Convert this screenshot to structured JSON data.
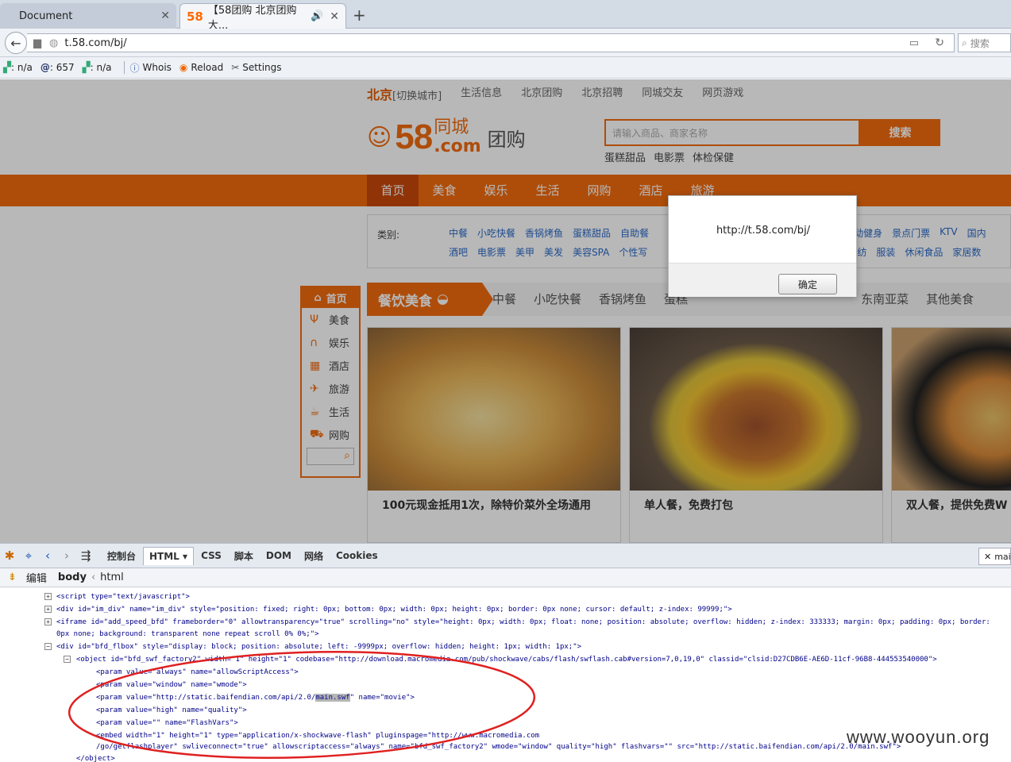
{
  "browser": {
    "tabs": [
      {
        "label": "Document"
      },
      {
        "label": "【58团购 北京团购大..."
      }
    ],
    "url": "t.58.com/bj/",
    "search_placeholder": "搜索",
    "addons": {
      "pr_value": ": n/a",
      "alexa_value": ": 657",
      "pr2_value": ": n/a",
      "whois": "Whois",
      "reload": "Reload",
      "settings": "Settings"
    }
  },
  "site": {
    "city": "北京",
    "switch_city": "[切换城市]",
    "top_links": [
      "生活信息",
      "北京团购",
      "北京招聘",
      "同城交友",
      "网页游戏"
    ],
    "logo_58": "58",
    "logo_tc": "同城",
    "logo_com": ".com",
    "logo_tg": "团购",
    "search_placeholder": "请输入商品、商家名称",
    "search_button": "搜索",
    "hot_words": [
      "蛋糕甜品",
      "电影票",
      "体检保健"
    ],
    "main_nav": [
      "首页",
      "美食",
      "娱乐",
      "生活",
      "网购",
      "酒店",
      "旅游"
    ],
    "category_label": "类别:",
    "category_row1": [
      "中餐",
      "小吃快餐",
      "香锅烤鱼",
      "蛋糕甜品",
      "自助餐",
      "运动健身",
      "景点门票",
      "KTV",
      "国内"
    ],
    "category_row2": [
      "酒吧",
      "电影票",
      "美甲",
      "美发",
      "美容SPA",
      "个性写",
      "品家纺",
      "服装",
      "休闲食品",
      "家居数"
    ],
    "sidebar": [
      "首页",
      "美食",
      "娱乐",
      "酒店",
      "旅游",
      "生活",
      "网购"
    ],
    "food_bar_label": "餐饮美食",
    "food_bar_items": [
      "中餐",
      "小吃快餐",
      "香锅烤鱼",
      "蛋糕",
      "东南亚菜",
      "其他美食"
    ],
    "cards": [
      {
        "caption": "100元现金抵用1次，除特价菜外全场通用"
      },
      {
        "caption": "单人餐，免费打包"
      },
      {
        "caption": "双人餐，提供免费W"
      }
    ]
  },
  "dialog": {
    "message": "http://t.58.com/bj/",
    "ok": "确定"
  },
  "devtools": {
    "tabs": [
      "控制台",
      "HTML",
      "CSS",
      "脚本",
      "DOM",
      "网络",
      "Cookies"
    ],
    "active_tab": "HTML",
    "edit": "编辑",
    "crumb_body": "body",
    "crumb_html": "html",
    "search_text": "mai",
    "lines": [
      "<script type=\"text/javascript\">",
      "<div id=\"im_div\" name=\"im_div\" style=\"position: fixed; right: 0px; bottom: 0px; width: 0px; height: 0px; border: 0px none; cursor: default; z-index: 99999;\">",
      "<iframe id=\"add_speed_bfd\" frameborder=\"0\" allowtransparency=\"true\" scrolling=\"no\" style=\"height: 0px; width: 0px; float: none; position: absolute; overflow: hidden; z-index: 333333; margin: 0px; padding: 0px; border:",
      "0px none; background: transparent none repeat scroll 0% 0%;\">",
      "<div id=\"bfd_flbox\" style=\"display: block; position: absolute; left: -9999px; overflow: hidden; height: 1px; width: 1px;\">",
      "<object id=\"bfd_swf_factory2\" width=\"1\" height=\"1\" codebase=\"http://download.macromedia.com/pub/shockwave/cabs/flash/swflash.cab#version=7,0,19,0\" classid=\"clsid:D27CDB6E-AE6D-11cf-96B8-444553540000\">",
      "<param value=\"always\" name=\"allowScriptAccess\">",
      "<param value=\"window\" name=\"wmode\">",
      "<param value=\"http://static.baifendian.com/api/2.0/",
      "main.swf",
      "\" name=\"movie\">",
      "<param value=\"high\" name=\"quality\">",
      "<param value=\"\" name=\"FlashVars\">",
      "<embed width=\"1\" height=\"1\" type=\"application/x-shockwave-flash\" pluginspage=\"http://www.macromedia.com",
      "/go/getflashplayer\" swliveconnect=\"true\" allowscriptaccess=\"always\" name=\"bfd_swf_factory2\" wmode=\"window\" quality=\"high\" flashvars=\"\" src=\"http://static.baifendian.com/api/2.0/main.swf\">",
      "</object>"
    ]
  },
  "watermark": "www.wooyun.org",
  "colors": {
    "brand": "#f26b0f",
    "annotation": "#e02020"
  }
}
